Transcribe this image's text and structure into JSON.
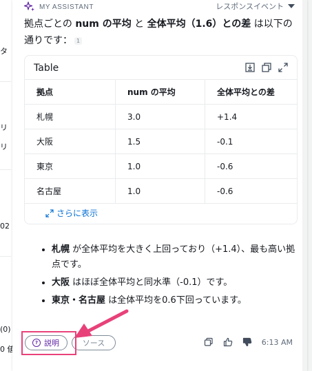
{
  "background": {
    "fragments": [
      "タ",
      "リ",
      "リ",
      "02",
      "(0)",
      "0 値"
    ]
  },
  "header": {
    "label": "MY ASSISTANT",
    "response_events": "レスポンスイベント"
  },
  "intro": {
    "p1": "拠点ごとの ",
    "b1": "num の平均",
    "p2": " と ",
    "b2": "全体平均（1.6）との差",
    "p3": " は以下の通りです：",
    "citation": "1"
  },
  "table": {
    "title": "Table",
    "columns": [
      "拠点",
      "num の平均",
      "全体平均との差"
    ],
    "rows": [
      [
        "札幌",
        "3.0",
        "+1.4"
      ],
      [
        "大阪",
        "1.5",
        "-0.1"
      ],
      [
        "東京",
        "1.0",
        "-0.6"
      ],
      [
        "名古屋",
        "1.0",
        "-0.6"
      ]
    ],
    "show_more": "さらに表示"
  },
  "bullets": [
    {
      "bold": "札幌",
      "text": " が全体平均を大きく上回っており（+1.4）、最も高い拠点です。"
    },
    {
      "bold": "大阪",
      "text": " はほぼ全体平均と同水準（-0.1）です。"
    },
    {
      "bold": "東京・名古屋",
      "text": " は全体平均を0.6下回っています。"
    }
  ],
  "footer": {
    "explain_label": "説明",
    "source_label": "ソース",
    "time": "6:13 AM"
  },
  "colors": {
    "accent_purple": "#5f23a4",
    "highlight_pink": "#e8417a",
    "link_blue": "#0972d3"
  }
}
